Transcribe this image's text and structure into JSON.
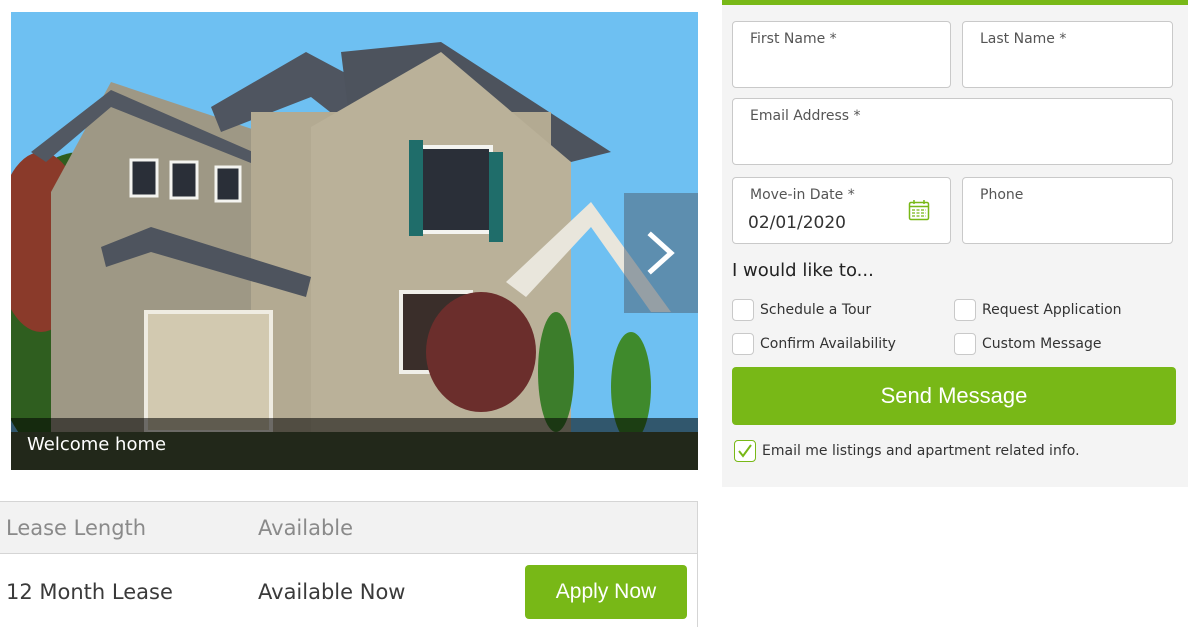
{
  "carousel": {
    "caption": "Welcome home",
    "next_icon": "chevron-right-icon"
  },
  "lease_table": {
    "headers": [
      "Lease Length",
      "Available"
    ],
    "rows": [
      {
        "lease_length": "12 Month Lease",
        "available": "Available Now",
        "action": "Apply Now"
      }
    ]
  },
  "contact_form": {
    "fields": {
      "first_name": {
        "label": "First Name *",
        "value": ""
      },
      "last_name": {
        "label": "Last Name *",
        "value": ""
      },
      "email": {
        "label": "Email Address *",
        "value": ""
      },
      "move_in_date": {
        "label": "Move-in Date *",
        "value": "02/01/2020",
        "icon": "calendar-icon"
      },
      "phone": {
        "label": "Phone",
        "value": ""
      }
    },
    "intent_heading": "I would like to...",
    "intents": [
      {
        "label": "Schedule a Tour",
        "checked": false
      },
      {
        "label": "Request Application",
        "checked": false
      },
      {
        "label": "Confirm Availability",
        "checked": false
      },
      {
        "label": "Custom Message",
        "checked": false
      }
    ],
    "submit_label": "Send Message",
    "optin": {
      "label": "Email me listings and apartment related info.",
      "checked": true
    }
  },
  "colors": {
    "accent_green": "#78b817",
    "panel_bg": "#f4f4f4",
    "table_header_bg": "#f2f2f2"
  }
}
